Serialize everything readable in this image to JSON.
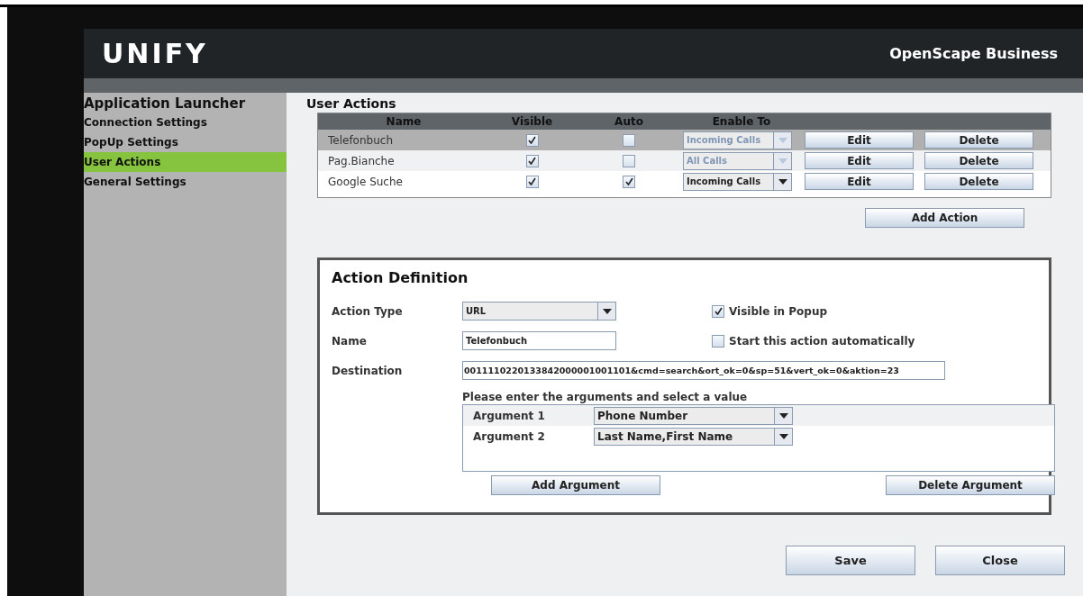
{
  "header": {
    "logo": "UNIFY",
    "product": "OpenScape Business"
  },
  "sidebar": {
    "title": "Application Launcher",
    "items": [
      {
        "label": "Connection Settings",
        "selected": false
      },
      {
        "label": "PopUp Settings",
        "selected": false
      },
      {
        "label": "User Actions",
        "selected": true
      },
      {
        "label": "General Settings",
        "selected": false
      }
    ]
  },
  "user_actions": {
    "title": "User Actions",
    "columns": [
      "Name",
      "Visible",
      "Auto",
      "Enable To"
    ],
    "rows": [
      {
        "name": "Telefonbuch",
        "visible": true,
        "auto": false,
        "enable_to": "Incoming Calls",
        "enable_to_disabled": true,
        "edit": "Edit",
        "delete": "Delete",
        "selected": true
      },
      {
        "name": "Pag.Bianche",
        "visible": true,
        "auto": false,
        "enable_to": "All Calls",
        "enable_to_disabled": true,
        "edit": "Edit",
        "delete": "Delete",
        "selected": false
      },
      {
        "name": "Google Suche",
        "visible": true,
        "auto": true,
        "enable_to": "Incoming Calls",
        "enable_to_disabled": false,
        "edit": "Edit",
        "delete": "Delete",
        "selected": false
      }
    ],
    "add_button": "Add Action"
  },
  "action_definition": {
    "title": "Action Definition",
    "action_type": {
      "label": "Action Type",
      "value": "URL"
    },
    "name": {
      "label": "Name",
      "value": "Telefonbuch"
    },
    "destination": {
      "label": "Destination",
      "value": "0011110220133842000001001101&cmd=search&ort_ok=0&sp=51&vert_ok=0&aktion=23"
    },
    "visible_in_popup": {
      "label": "Visible in Popup",
      "checked": true
    },
    "start_automatically": {
      "label": "Start this action automatically",
      "checked": false
    },
    "arguments_prompt": "Please enter the arguments and select a value",
    "arguments": [
      {
        "label": "Argument 1",
        "value": "Phone Number"
      },
      {
        "label": "Argument 2",
        "value": "Last Name,First Name"
      }
    ],
    "add_argument": "Add Argument",
    "delete_argument": "Delete Argument"
  },
  "buttons": [
    "Save",
    "Close"
  ]
}
